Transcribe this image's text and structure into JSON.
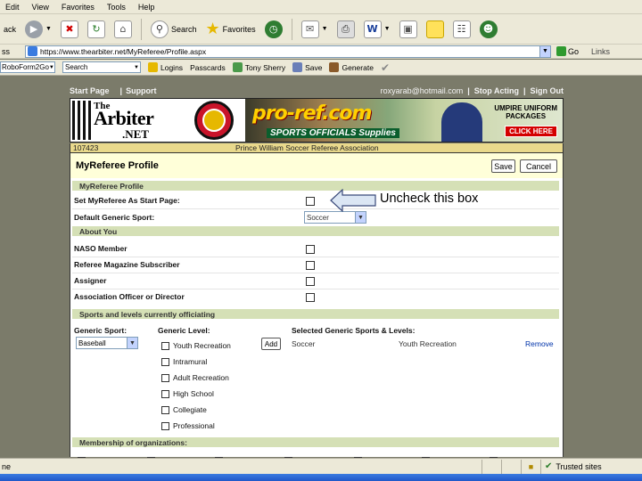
{
  "browser": {
    "menu": [
      "Edit",
      "View",
      "Favorites",
      "Tools",
      "Help"
    ],
    "toolbar": {
      "back_label": "ack",
      "search_label": "Search",
      "favorites_label": "Favorites"
    },
    "address": {
      "label": "ss",
      "url": "https://www.thearbiter.net/MyReferee/Profile.aspx",
      "go_label": "Go",
      "links_label": "Links"
    },
    "robo": {
      "roboform_label": "RoboForm2Go",
      "search_value": "Search",
      "logins_label": "Logins",
      "passcards_label": "Passcards",
      "identity_label": "Tony Sherry",
      "save_label": "Save",
      "generate_label": "Generate"
    },
    "status": {
      "left_text": "ne",
      "zone_label": "Trusted sites"
    }
  },
  "site": {
    "nav": {
      "start_page": "Start Page",
      "separator": "|",
      "support": "Support",
      "email": "roxyarab@hotmail.com",
      "stop_acting": "Stop Acting",
      "sign_out": "Sign Out"
    },
    "banner": {
      "arbiter_the": "The",
      "arbiter_name": "Arbiter",
      "arbiter_net": ".NET",
      "proref_logo": "pro-ref.com",
      "proref_tagline": "SPORTS OFFICIALS Supplies",
      "umpire_line1": "UMPIRE UNIFORM",
      "umpire_line2": "PACKAGES",
      "click_here": "CLICK HERE"
    },
    "assoc": {
      "id": "107423",
      "name": "Prince William Soccer Referee Association"
    }
  },
  "profile": {
    "title": "MyReferee Profile",
    "save_button": "Save",
    "cancel_button": "Cancel",
    "section_profile": "MyReferee Profile",
    "start_page_label": "Set MyReferee As Start Page:",
    "start_page_checked": false,
    "default_sport_label": "Default Generic Sport:",
    "default_sport_value": "Soccer",
    "section_about": "About You",
    "about_items": [
      {
        "label": "NASO Member",
        "checked": false
      },
      {
        "label": "Referee Magazine Subscriber",
        "checked": false
      },
      {
        "label": "Assigner",
        "checked": false
      },
      {
        "label": "Association Officer or Director",
        "checked": false
      }
    ],
    "section_sports": "Sports and levels currently officiating",
    "generic_sport_label": "Generic Sport:",
    "generic_sport_value": "Baseball",
    "generic_level_label": "Generic Level:",
    "levels": [
      "Youth Recreation",
      "Intramural",
      "Adult Recreation",
      "High School",
      "Collegiate",
      "Professional"
    ],
    "add_button": "Add",
    "selected_label": "Selected Generic Sports & Levels:",
    "selected_sport": "Soccer",
    "selected_level": "Youth Recreation",
    "remove_link": "Remove",
    "section_membership": "Membership of organizations:"
  },
  "annotation": {
    "callout_text": "Uncheck this box"
  }
}
